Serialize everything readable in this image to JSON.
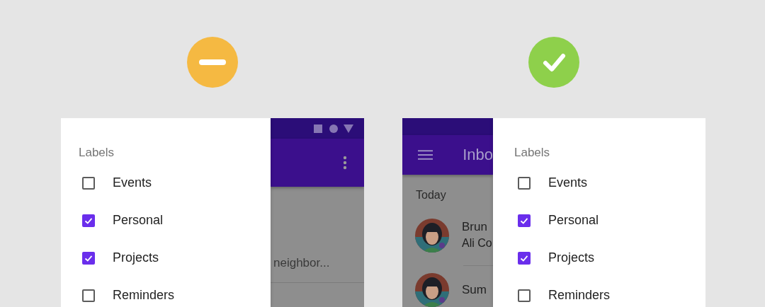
{
  "examples": [
    {
      "badge": {
        "kind": "minus",
        "color": "#f5b942"
      },
      "drawer_on_right": false,
      "drawer": {
        "title": "Labels",
        "items": [
          {
            "label": "Events",
            "checked": false
          },
          {
            "label": "Personal",
            "checked": true
          },
          {
            "label": "Projects",
            "checked": true
          },
          {
            "label": "Reminders",
            "checked": false
          }
        ]
      },
      "app": {
        "messages": [
          {
            "preview": "neighbor..."
          }
        ]
      }
    },
    {
      "badge": {
        "kind": "check",
        "color": "#8ed04b"
      },
      "drawer_on_right": true,
      "drawer": {
        "title": "Labels",
        "items": [
          {
            "label": "Events",
            "checked": false
          },
          {
            "label": "Personal",
            "checked": true
          },
          {
            "label": "Projects",
            "checked": true
          },
          {
            "label": "Reminders",
            "checked": false
          }
        ]
      },
      "app": {
        "title": "Inbo",
        "section": "Today",
        "messages": [
          {
            "sender": "Brun",
            "preview": "Ali Co"
          },
          {
            "sender": "Sum"
          }
        ]
      }
    }
  ]
}
